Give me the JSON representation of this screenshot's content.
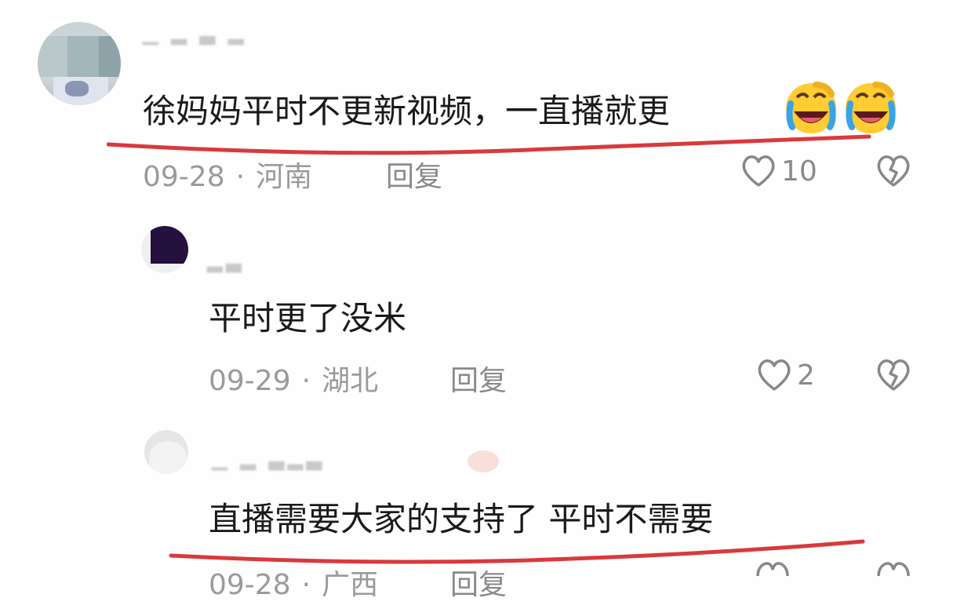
{
  "comments": [
    {
      "text": "徐妈妈平时不更新视频，一直播就更",
      "date": "09-28",
      "separator": "·",
      "location": "河南",
      "reply_label": "回复",
      "likes": "10",
      "emoji": [
        "laughing-crying-emoji",
        "laughing-crying-emoji"
      ]
    },
    {
      "text": "平时更了没米",
      "date": "09-29",
      "separator": "·",
      "location": "湖北",
      "reply_label": "回复",
      "likes": "2"
    },
    {
      "text": "直播需要大家的支持了 平时不需要",
      "date": "09-28",
      "separator": "·",
      "location": "广西",
      "reply_label": "回复"
    }
  ],
  "colors": {
    "underline": "#d9393d",
    "text": "#1a1a1a",
    "meta": "#9a9a9a"
  }
}
